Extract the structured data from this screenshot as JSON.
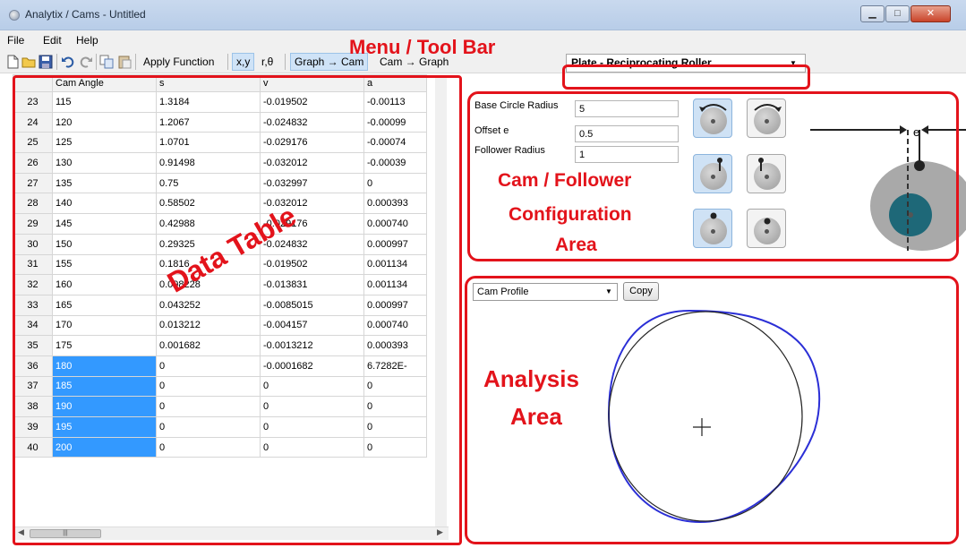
{
  "window": {
    "title": "Analytix / Cams - Untitled",
    "min": "▁",
    "max": "□",
    "close": "✕"
  },
  "menu": [
    "File",
    "Edit",
    "Help"
  ],
  "toolbar": {
    "apply_function": "Apply Function",
    "xy": "x,y",
    "rtheta": "r,θ",
    "graph_to_cam": "Graph → Cam",
    "cam_to_graph": "Cam → Graph",
    "mode_value": "Plate - Reciprocating Roller",
    "icons": [
      "new-icon",
      "open-icon",
      "save-icon",
      "undo-icon",
      "redo-icon",
      "copy-icon",
      "paste-icon"
    ]
  },
  "annotations": {
    "menu_toolbar": "Menu / Tool Bar",
    "config_line1": "Cam / Follower",
    "config_line2": "Configuration",
    "config_line3": "Area",
    "data_table": "Data Table",
    "analysis_line1": "Analysis",
    "analysis_line2": "Area",
    "color": "#e3131b"
  },
  "table": {
    "columns": [
      "",
      "Cam Angle",
      "s",
      "v",
      "a"
    ],
    "rows": [
      [
        "23",
        "115",
        "1.3184",
        "-0.019502",
        "-0.00113"
      ],
      [
        "24",
        "120",
        "1.2067",
        "-0.024832",
        "-0.00099"
      ],
      [
        "25",
        "125",
        "1.0701",
        "-0.029176",
        "-0.00074"
      ],
      [
        "26",
        "130",
        "0.91498",
        "-0.032012",
        "-0.00039"
      ],
      [
        "27",
        "135",
        "0.75",
        "-0.032997",
        "0"
      ],
      [
        "28",
        "140",
        "0.58502",
        "-0.032012",
        "0.000393"
      ],
      [
        "29",
        "145",
        "0.42988",
        "-0.029176",
        "0.000740"
      ],
      [
        "30",
        "150",
        "0.29325",
        "-0.024832",
        "0.000997"
      ],
      [
        "31",
        "155",
        "0.1816",
        "-0.019502",
        "0.001134"
      ],
      [
        "32",
        "160",
        "0.098228",
        "-0.013831",
        "0.001134"
      ],
      [
        "33",
        "165",
        "0.043252",
        "-0.0085015",
        "0.000997"
      ],
      [
        "34",
        "170",
        "0.013212",
        "-0.004157",
        "0.000740"
      ],
      [
        "35",
        "175",
        "0.001682",
        "-0.0013212",
        "0.000393"
      ],
      [
        "36",
        "180",
        "0",
        "-0.0001682",
        "6.7282E-"
      ],
      [
        "37",
        "185",
        "0",
        "0",
        "0"
      ],
      [
        "38",
        "190",
        "0",
        "0",
        "0"
      ],
      [
        "39",
        "195",
        "0",
        "0",
        "0"
      ],
      [
        "40",
        "200",
        "0",
        "0",
        "0"
      ]
    ],
    "selected_from_row": 13
  },
  "config": {
    "base_circle_radius_label": "Base Circle Radius",
    "base_circle_radius_value": "5",
    "offset_label": "Offset e",
    "offset_value": "0.5",
    "follower_radius_label": "Follower Radius",
    "follower_radius_value": "1",
    "diagram_label": "e"
  },
  "analysis": {
    "select_value": "Cam Profile",
    "copy_label": "Copy",
    "plus": "+"
  }
}
